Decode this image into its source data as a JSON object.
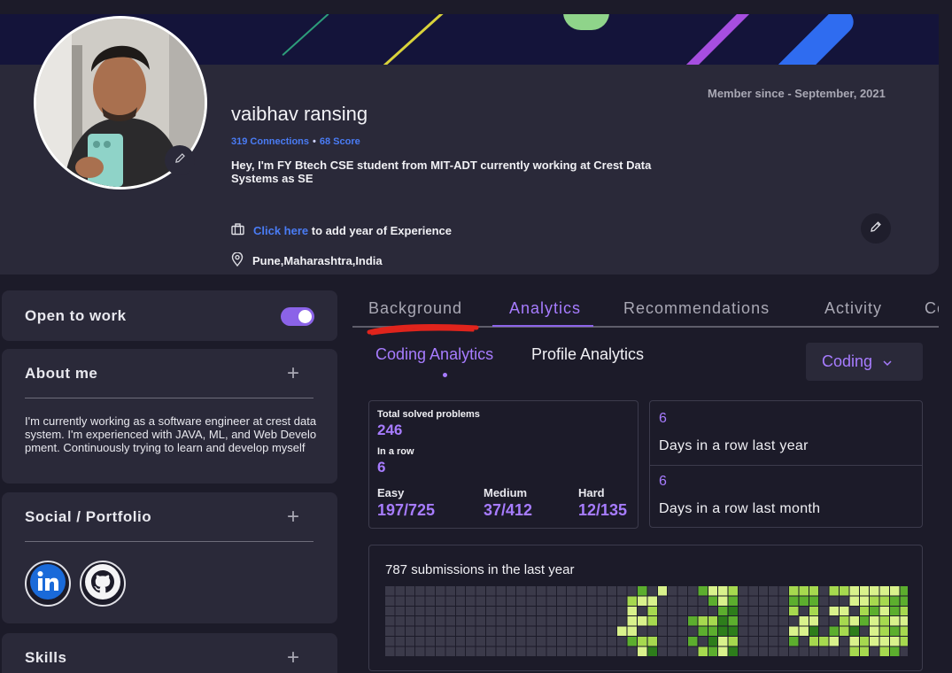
{
  "profile": {
    "name": "vaibhav ransing",
    "member_since": "Member since - September, 2021",
    "connections": "319 Connections",
    "separator": "•",
    "score": "68 Score",
    "bio": "Hey, I'm FY Btech CSE student from MIT-ADT currently working at Crest Data Systems as SE",
    "experience_link": "Click here",
    "experience_rest": "to add year of Experience",
    "location": "Pune,Maharashtra,India"
  },
  "sidebar": {
    "open_to_work": {
      "label": "Open to work",
      "enabled": true
    },
    "about": {
      "title": "About me",
      "plus": "+",
      "text": "I'm currently working as a software engineer at crest data system. I'm experienced with JAVA, ML, and Web Development. Continuously trying to learn and develop myself"
    },
    "social": {
      "title": "Social / Portfolio",
      "plus": "+",
      "links": [
        "linkedin-icon",
        "github-icon"
      ]
    },
    "skills": {
      "title": "Skills",
      "plus": "+"
    }
  },
  "tabs": {
    "items": [
      "Background",
      "Analytics",
      "Recommendations",
      "Activity",
      "Co"
    ],
    "active": "Analytics"
  },
  "subtabs": {
    "items": [
      "Coding Analytics",
      "Profile Analytics"
    ],
    "active": "Coding Analytics",
    "dropdown": "Coding"
  },
  "coding_stats": {
    "total_label": "Total solved problems",
    "total_value": "246",
    "row_label": "In a row",
    "row_value": "6",
    "easy_label": "Easy",
    "easy_value": "197/725",
    "medium_label": "Medium",
    "medium_value": "37/412",
    "hard_label": "Hard",
    "hard_value": "12/135"
  },
  "streaks": {
    "year_value": "6",
    "year_label": "Days in a row last year",
    "month_value": "6",
    "month_label": "Days in a row last month"
  },
  "submissions": {
    "title": "787 submissions in the last year",
    "colors": {
      "empty": "#3b3a4a",
      "l1": "#d9f28c",
      "l2": "#a6d94f",
      "l3": "#5cae2e",
      "l4": "#2d7d1b"
    },
    "grid": [
      "0000000000000000000000000301000311200000222022111113",
      "0000000000000000000000002110000031300000333000112233",
      "0000000000000000000000001020000003400000202011023132",
      "0000000000000000000000001120003224300000011002131211",
      "0000000000000000000000011000000334400000114032401232",
      "0000000000000000000000003220003041200000302210121112",
      "0000000000000000000000000140000231400000000000220230"
    ]
  }
}
